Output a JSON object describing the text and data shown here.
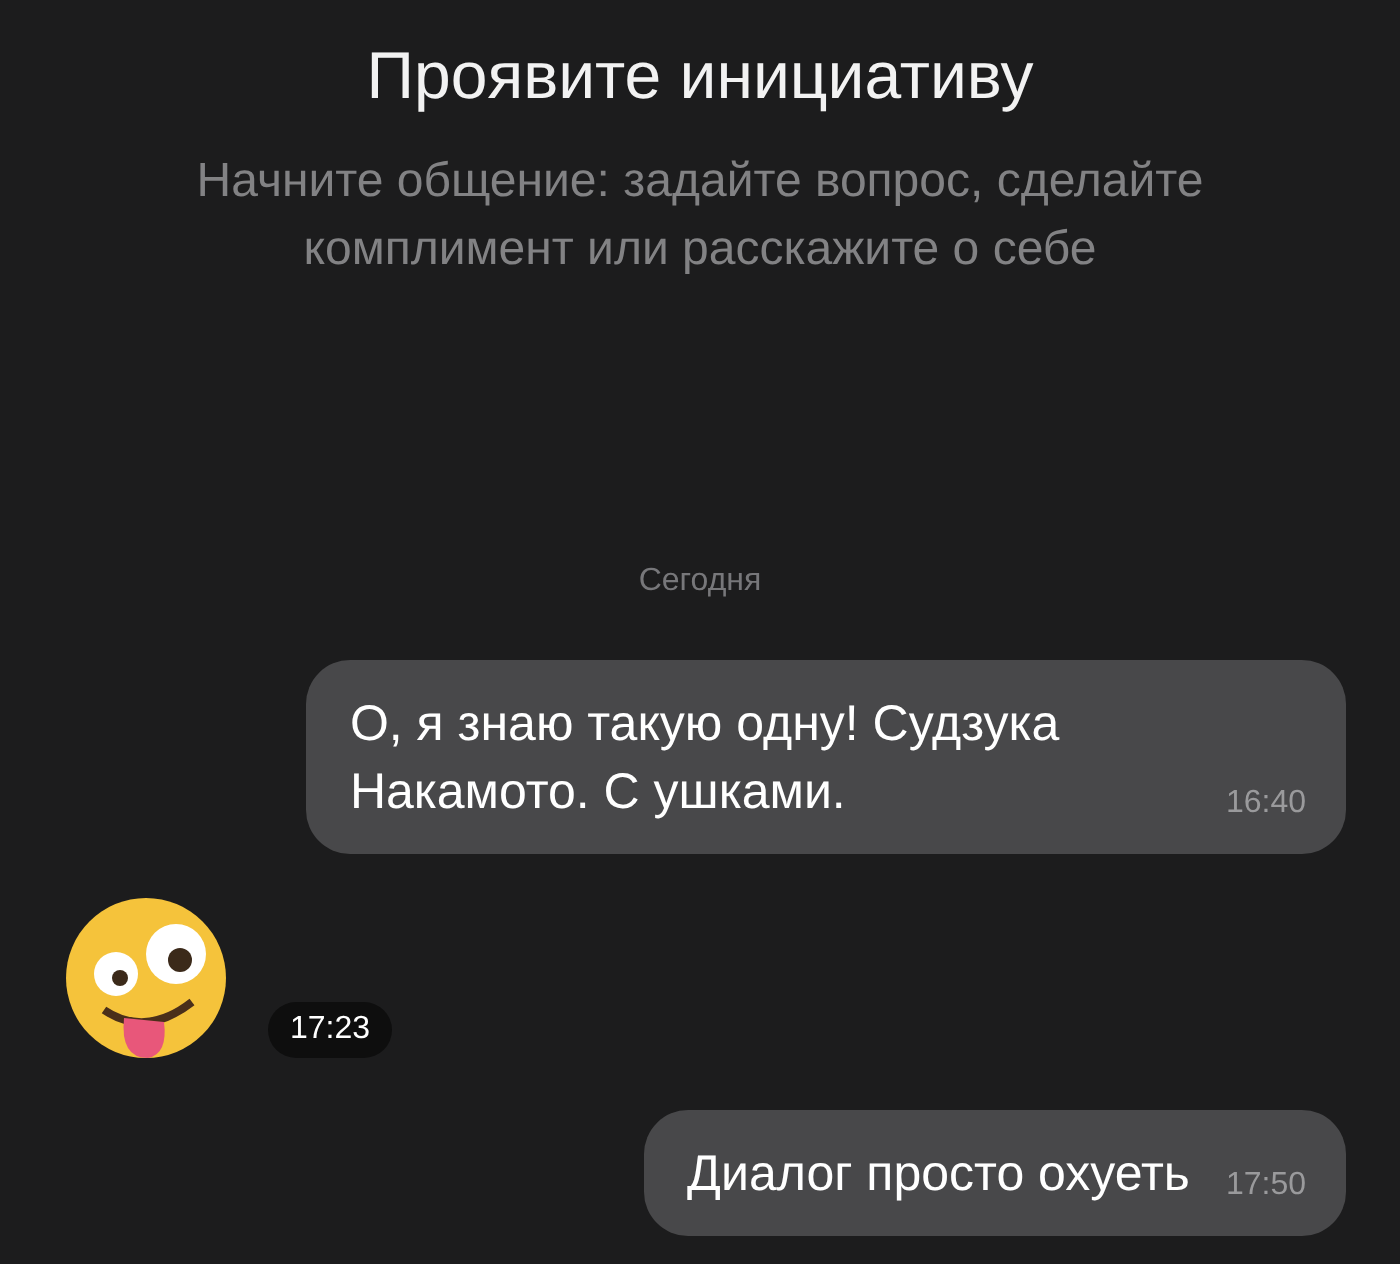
{
  "header": {
    "title": "Проявите инициативу",
    "subtitle": "Начните общение: задайте вопрос, сделайте комплимент или расскажите о себе"
  },
  "date_divider": "Сегодня",
  "messages": [
    {
      "kind": "text",
      "text": "О, я знаю такую одну! Судзука Накамото. С ушками.",
      "time": "16:40"
    },
    {
      "kind": "sticker",
      "time": "17:23"
    },
    {
      "kind": "text",
      "text": "Диалог просто охуеть",
      "time": "17:50"
    }
  ]
}
